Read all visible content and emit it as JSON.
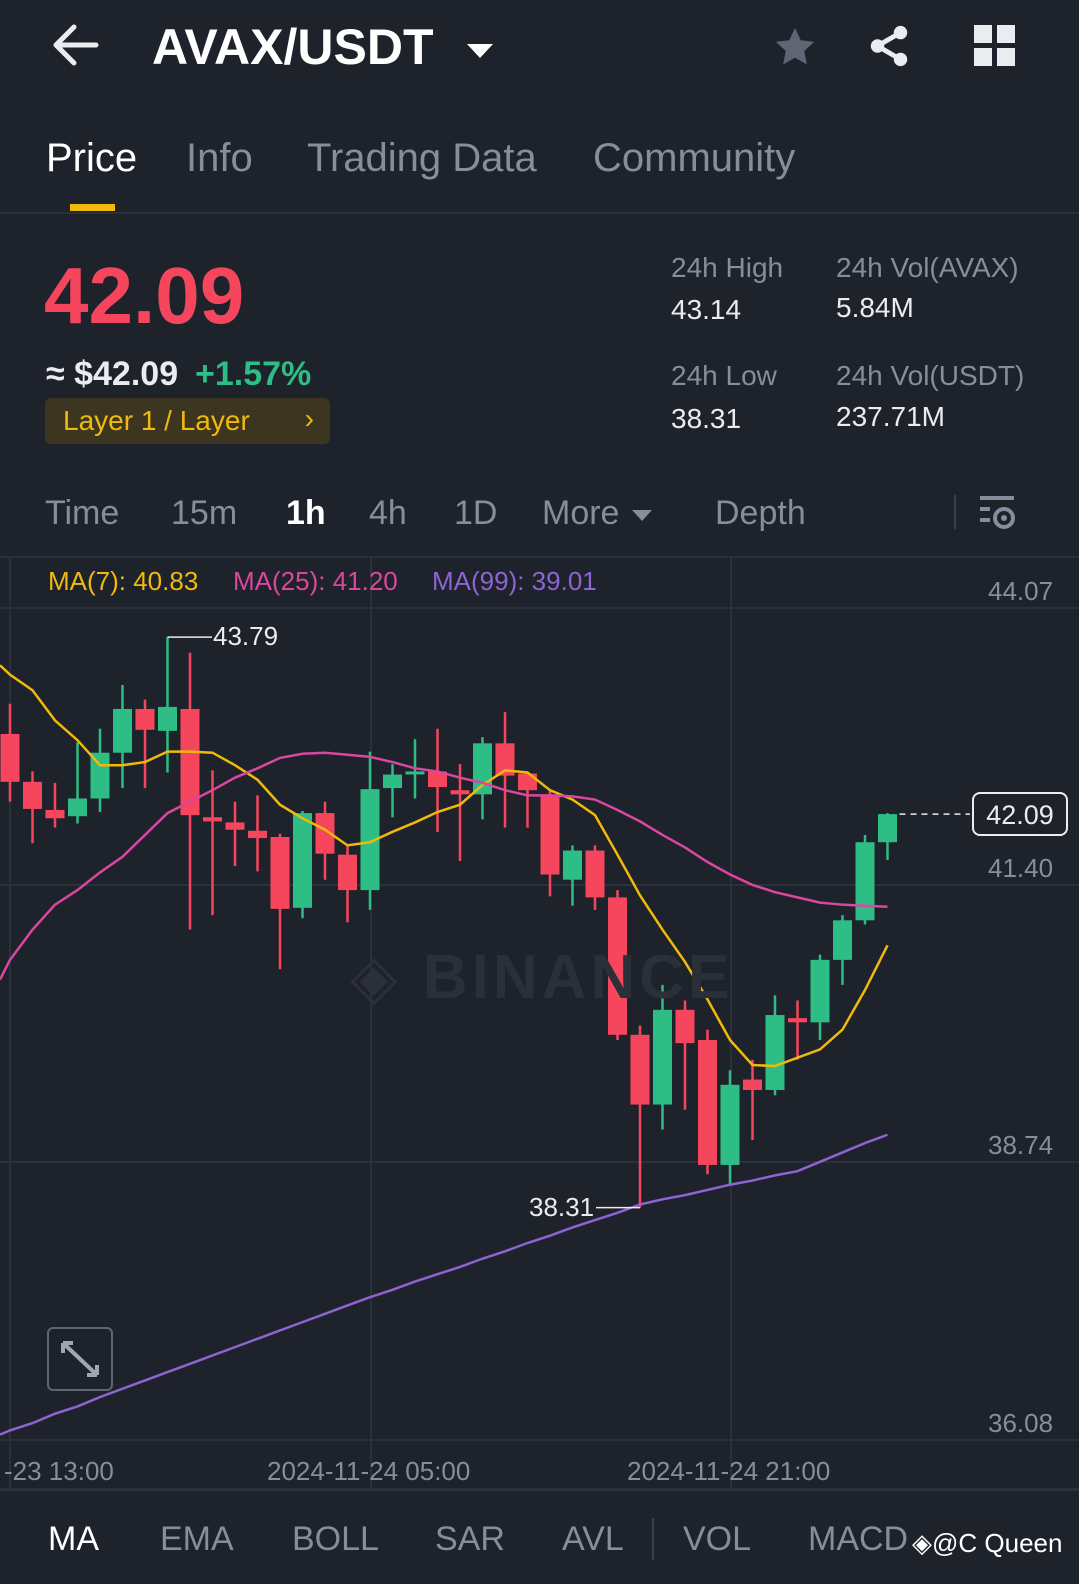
{
  "header": {
    "pair": "AVAX/USDT"
  },
  "tabs": [
    "Price",
    "Info",
    "Trading Data",
    "Community"
  ],
  "price": {
    "last": "42.09",
    "usd": "≈ $42.09",
    "change": "+1.57%",
    "tag": "Layer 1 / Layer"
  },
  "stats": {
    "high_label": "24h High",
    "high": "43.14",
    "low_label": "24h Low",
    "low": "38.31",
    "vol_base_label": "24h Vol(AVAX)",
    "vol_base": "5.84M",
    "vol_quote_label": "24h Vol(USDT)",
    "vol_quote": "237.71M"
  },
  "intervals": [
    "Time",
    "15m",
    "1h",
    "4h",
    "1D",
    "More",
    "Depth"
  ],
  "ma_legend": {
    "ma7": "MA(7): 40.83",
    "ma25": "MA(25): 41.20",
    "ma99": "MA(99): 39.01"
  },
  "watermark": "BINANCE",
  "indicators": [
    "MA",
    "EMA",
    "BOLL",
    "SAR",
    "AVL",
    "VOL",
    "MACD"
  ],
  "credit": "@C Queen",
  "colors": {
    "up": "#2ebd85",
    "down": "#f6465d",
    "ma7": "#f0b90b",
    "ma25": "#d9479f",
    "ma99": "#8e63d2",
    "accent": "#f0b90b"
  },
  "chart_data": {
    "type": "candlestick",
    "interval": "1h",
    "y_ticks": [
      "44.07",
      "41.40",
      "38.74",
      "36.08"
    ],
    "x_ticks": [
      "-23 13:00",
      "2024-11-24 05:00",
      "2024-11-24 21:00"
    ],
    "ylim": [
      36.08,
      44.07
    ],
    "high_marker": "43.79",
    "low_marker": "38.31",
    "last_price_label": "42.09",
    "ohlc": [
      [
        42.86,
        43.15,
        42.21,
        42.4
      ],
      [
        42.4,
        42.5,
        41.81,
        42.14
      ],
      [
        42.13,
        42.39,
        41.96,
        42.05
      ],
      [
        42.07,
        42.78,
        42.0,
        42.24
      ],
      [
        42.24,
        42.91,
        42.11,
        42.68
      ],
      [
        42.68,
        43.33,
        42.34,
        43.1
      ],
      [
        43.1,
        43.19,
        42.34,
        42.9
      ],
      [
        42.89,
        43.79,
        42.49,
        43.12
      ],
      [
        43.1,
        43.64,
        40.98,
        42.08
      ],
      [
        42.06,
        42.51,
        41.12,
        42.02
      ],
      [
        42.01,
        42.21,
        41.59,
        41.94
      ],
      [
        41.93,
        42.27,
        41.54,
        41.86
      ],
      [
        41.87,
        41.9,
        40.6,
        41.18
      ],
      [
        41.19,
        42.12,
        41.09,
        42.1
      ],
      [
        42.1,
        42.21,
        41.46,
        41.71
      ],
      [
        41.7,
        41.8,
        41.05,
        41.36
      ],
      [
        41.36,
        42.69,
        41.17,
        42.33
      ],
      [
        42.34,
        42.57,
        42.06,
        42.47
      ],
      [
        42.48,
        42.81,
        42.24,
        42.5
      ],
      [
        42.5,
        42.91,
        41.92,
        42.35
      ],
      [
        42.32,
        42.57,
        41.64,
        42.28
      ],
      [
        42.28,
        42.83,
        42.04,
        42.77
      ],
      [
        42.77,
        43.07,
        41.96,
        42.46
      ],
      [
        42.48,
        42.49,
        41.96,
        42.32
      ],
      [
        42.27,
        42.32,
        41.3,
        41.51
      ],
      [
        41.46,
        41.79,
        41.21,
        41.74
      ],
      [
        41.74,
        41.79,
        41.17,
        41.29
      ],
      [
        41.29,
        41.36,
        39.92,
        39.97
      ],
      [
        39.97,
        40.06,
        38.31,
        39.3
      ],
      [
        39.3,
        40.45,
        39.06,
        40.21
      ],
      [
        40.21,
        40.3,
        39.25,
        39.89
      ],
      [
        39.92,
        40.02,
        38.63,
        38.72
      ],
      [
        38.72,
        39.63,
        38.53,
        39.49
      ],
      [
        39.54,
        39.73,
        38.96,
        39.44
      ],
      [
        39.44,
        40.35,
        39.39,
        40.16
      ],
      [
        40.13,
        40.3,
        39.73,
        40.09
      ],
      [
        40.09,
        40.74,
        39.92,
        40.69
      ],
      [
        40.69,
        41.12,
        40.45,
        41.07
      ],
      [
        41.07,
        41.89,
        41.03,
        41.82
      ],
      [
        41.82,
        42.1,
        41.65,
        42.09
      ]
    ],
    "ma7": [
      43.43,
      43.28,
      42.99,
      42.8,
      42.56,
      42.56,
      42.59,
      42.69,
      42.69,
      42.68,
      42.56,
      42.42,
      42.18,
      42.05,
      41.94,
      41.79,
      41.82,
      41.92,
      42.01,
      42.11,
      42.18,
      42.37,
      42.51,
      42.49,
      42.32,
      42.23,
      42.08,
      41.7,
      41.31,
      40.98,
      40.67,
      40.31,
      39.92,
      39.68,
      39.67,
      39.75,
      39.83,
      40.02,
      40.4,
      40.83
    ],
    "ma25": [
      40.69,
      40.98,
      41.22,
      41.36,
      41.53,
      41.68,
      41.89,
      42.1,
      42.21,
      42.32,
      42.44,
      42.53,
      42.63,
      42.67,
      42.68,
      42.66,
      42.64,
      42.59,
      42.53,
      42.5,
      42.44,
      42.39,
      42.32,
      42.27,
      42.27,
      42.26,
      42.23,
      42.13,
      42.02,
      41.89,
      41.77,
      41.63,
      41.51,
      41.41,
      41.34,
      41.29,
      41.24,
      41.22,
      41.21,
      41.2
    ],
    "ma99": [
      36.17,
      36.24,
      36.33,
      36.4,
      36.49,
      36.57,
      36.65,
      36.73,
      36.81,
      36.89,
      36.97,
      37.05,
      37.13,
      37.21,
      37.29,
      37.37,
      37.45,
      37.52,
      37.6,
      37.67,
      37.74,
      37.82,
      37.89,
      37.97,
      38.04,
      38.12,
      38.19,
      38.26,
      38.34,
      38.39,
      38.43,
      38.48,
      38.53,
      38.57,
      38.62,
      38.66,
      38.75,
      38.84,
      38.93,
      39.01
    ]
  }
}
